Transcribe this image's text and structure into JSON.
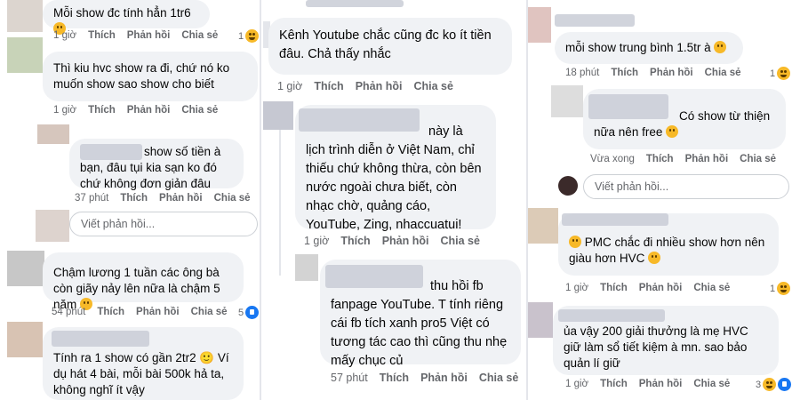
{
  "col1": {
    "c1": {
      "text": "Mỗi show đc tính hẳn 1tr6",
      "emoji": "laugh-tears-emoji",
      "actions": [
        "1 giờ",
        "Thích",
        "Phản hồi",
        "Chia sẻ"
      ],
      "react_count": "1",
      "react_icon": "haha-icon"
    },
    "c2": {
      "text": "Thì kiu hvc show ra đi, chứ nó ko muốn show sao show cho biết",
      "actions": [
        "1 giờ",
        "Thích",
        "Phản hồi",
        "Chia sẻ"
      ]
    },
    "c3": {
      "text": "show số tiền à bạn, đâu tụi kia sạn ko đó chứ không đơn giản đâu",
      "actions": [
        "37 phút",
        "Thích",
        "Phản hồi",
        "Chia sẻ"
      ]
    },
    "reply_placeholder": "Viết phản hồi...",
    "c4": {
      "text": "Chậm lương 1 tuần các ông bà còn giãy nảy lên nữa là chậm 5 năm",
      "emoji": "sweat-smile-emoji",
      "actions": [
        "54 phút",
        "Thích",
        "Phản hồi",
        "Chia sẻ"
      ],
      "react_count": "5",
      "react_icon": "like-icon"
    },
    "c5": {
      "text": "Tính ra 1 show có gần 2tr2 🙂 Ví dụ hát 4 bài, mỗi bài 500k hả ta, không nghĩ ít vậy"
    }
  },
  "col2": {
    "c1": {
      "text": "Kênh Youtube chắc cũng đc ko ít tiền đâu. Chả thấy nhắc",
      "actions": [
        "1 giờ",
        "Thích",
        "Phản hồi",
        "Chia sẻ"
      ]
    },
    "c2": {
      "text": "này là lịch trình diễn ở Việt Nam, chỉ thiếu chứ không thừa, còn bên nước ngoài chưa biết, còn nhạc chờ, quảng cáo, YouTube, Zing, nhaccuatui!",
      "actions": [
        "1 giờ",
        "Thích",
        "Phản hồi",
        "Chia sẻ"
      ]
    },
    "c3": {
      "text": "thu hồi fb fanpage YouTube. T tính riêng cái fb tích xanh pro5 Việt có tương tác cao thì cũng thu nhẹ mấy chục củ",
      "actions": [
        "57 phút",
        "Thích",
        "Phản hồi",
        "Chia sẻ"
      ]
    }
  },
  "col3": {
    "c1": {
      "text": "mỗi show trung bình 1.5tr à",
      "emoji": "slight-smile-emoji",
      "actions": [
        "18 phút",
        "Thích",
        "Phản hồi",
        "Chia sẻ"
      ],
      "react_count": "1",
      "react_icon": "haha-icon"
    },
    "c2": {
      "text": "Có show từ thiện nữa nên free",
      "emoji": "grin-tongue-emoji",
      "actions": [
        "Vừa xong",
        "Thích",
        "Phản hồi",
        "Chia sẻ"
      ]
    },
    "reply_placeholder": "Viết phản hồi...",
    "c3": {
      "text": "PMC chắc đi nhiều show hơn nên giàu hơn HVC",
      "actions": [
        "1 giờ",
        "Thích",
        "Phản hồi",
        "Chia sẻ"
      ],
      "react_count": "1",
      "react_icon": "haha-icon"
    },
    "c4": {
      "text": "ủa vậy 200 giải thưởng là mẹ HVC giữ làm sổ tiết kiệm à mn. sao bảo quản lí giữ",
      "actions": [
        "1 giờ",
        "Thích",
        "Phản hồi",
        "Chia sẻ"
      ],
      "react_count": "3",
      "react_icon": "haha-like-icons"
    }
  }
}
